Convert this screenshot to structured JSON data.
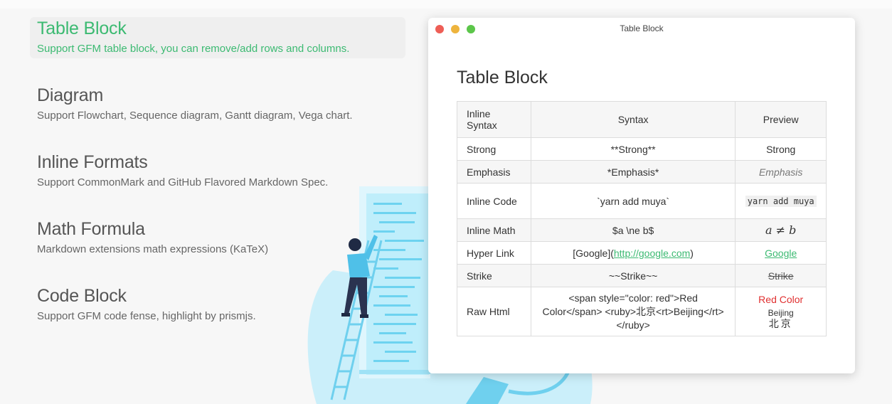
{
  "features": [
    {
      "title": "Table Block",
      "desc": "Support GFM table block, you can remove/add rows and columns.",
      "active": true
    },
    {
      "title": "Diagram",
      "desc": "Support Flowchart, Sequence diagram, Gantt diagram, Vega chart."
    },
    {
      "title": "Inline Formats",
      "desc": "Support CommonMark and GitHub Flavored Markdown Spec."
    },
    {
      "title": "Math Formula",
      "desc": "Markdown extensions math expressions (KaTeX)"
    },
    {
      "title": "Code Block",
      "desc": "Support GFM code fense, highlight by prismjs."
    }
  ],
  "window": {
    "title": "Table Block",
    "heading": "Table Block",
    "table": {
      "headers": [
        "Inline Syntax",
        "Syntax",
        "Preview"
      ],
      "rows": [
        {
          "name": "Strong",
          "syntax": "**Strong**",
          "preview": "Strong"
        },
        {
          "name": "Emphasis",
          "syntax": "*Emphasis*",
          "preview": "Emphasis"
        },
        {
          "name": "Inline Code",
          "syntax": "`yarn add muya`",
          "preview": "yarn add muya"
        },
        {
          "name": "Inline Math",
          "syntax": "$a \\ne b$",
          "preview": "a ≠ b"
        },
        {
          "name": "Hyper Link",
          "syntax_prefix": "[Google](",
          "syntax_link": "http://google.com",
          "syntax_suffix": ")",
          "preview": "Google"
        },
        {
          "name": "Strike",
          "syntax": "~~Strike~~",
          "preview": "Strike"
        },
        {
          "name": "Raw Html",
          "syntax": "<span style=\"color: red\">Red Color</span> <ruby>北京<rt>Beijing</rt></ruby>",
          "preview_red": "Red Color",
          "preview_ruby_rt": "Beijing",
          "preview_ruby_base": "北京"
        }
      ]
    }
  },
  "colors": {
    "accent": "#3cba72",
    "illustration": "#7fd8f0"
  },
  "icons": [
    "window-close-dot",
    "window-minimize-dot",
    "window-zoom-dot"
  ]
}
